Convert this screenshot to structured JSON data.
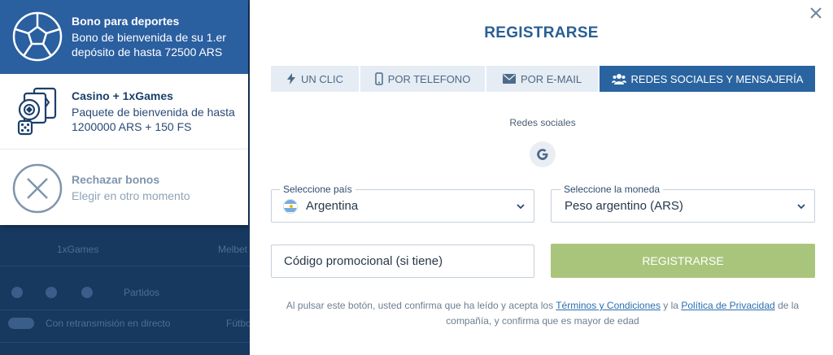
{
  "background": {
    "rows": [
      "1xGames",
      "Melbet",
      "Partidos",
      "Con retransmisión en directo",
      "Fútbol"
    ]
  },
  "bonus": {
    "sports": {
      "title": "Bono para deportes",
      "desc": "Bono de bienvenida de su 1.er depósito de hasta 72500 ARS"
    },
    "casino": {
      "title": "Casino + 1xGames",
      "desc": "Paquete de bienvenida de hasta 1200000 ARS + 150 FS"
    },
    "reject": {
      "title": "Rechazar bonos",
      "desc": "Elegir en otro momento"
    }
  },
  "modal": {
    "title": "REGISTRARSE",
    "close_icon": "close-icon",
    "tabs": [
      {
        "label": "UN CLIC",
        "icon": "lightning-icon"
      },
      {
        "label": "POR TELEFONO",
        "icon": "phone-icon"
      },
      {
        "label": "POR E-MAIL",
        "icon": "envelope-icon"
      },
      {
        "label": "REDES SOCIALES Y MENSAJERÍA",
        "icon": "users-icon",
        "active": true
      }
    ],
    "social_label": "Redes sociales",
    "google_icon": "google-icon",
    "country": {
      "label": "Seleccione país",
      "value": "Argentina"
    },
    "currency": {
      "label": "Seleccione la moneda",
      "value": "Peso argentino (ARS)"
    },
    "promo": {
      "placeholder": "Código promocional (si tiene)"
    },
    "register_button": "REGISTRARSE",
    "terms": {
      "prefix": "Al pulsar este botón, usted confirma que ha leído y acepta los",
      "link1": "Términos y Condiciones",
      "middle": "y la",
      "link2": "Política de Privacidad",
      "suffix": "de la compañía, y confirma que es mayor de edad"
    }
  },
  "colors": {
    "primary": "#2a5fa0",
    "title": "#2a5f94",
    "register_disabled": "#a9c57c",
    "link": "#2a6fb0"
  }
}
